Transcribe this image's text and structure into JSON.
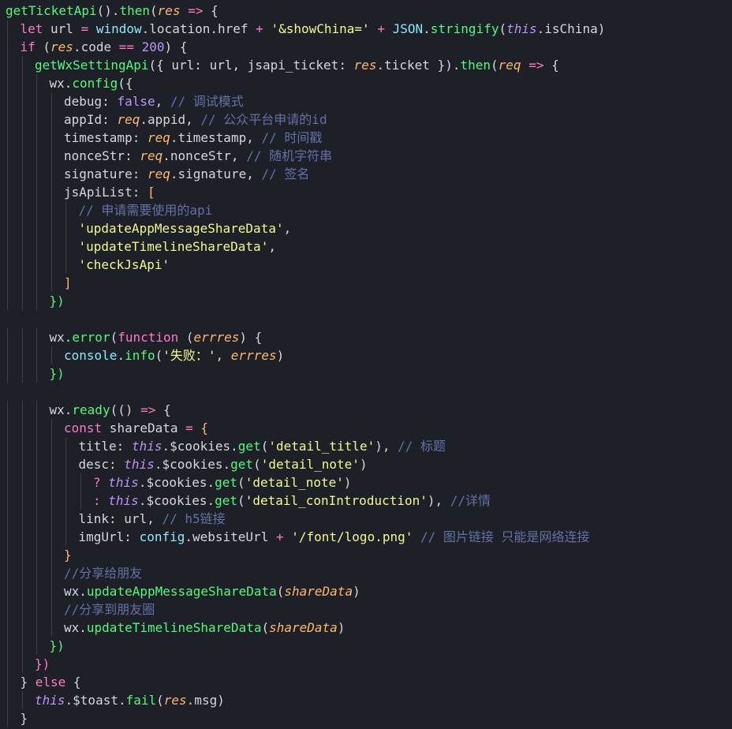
{
  "colors": {
    "background": "#1e2027",
    "default_text": "#d4d7de",
    "keyword": "#ff79c6",
    "function": "#50fa7b",
    "string": "#f1fa8c",
    "comment": "#6272a4",
    "param": "#ffb86c",
    "variable": "#8be9fd",
    "this": "#bd93f9",
    "number": "#bd93f9"
  },
  "editor": {
    "lines": [
      {
        "indent": 0,
        "tokens": [
          {
            "t": "getTicketApi",
            "c": "function"
          },
          {
            "t": "().",
            "c": "default"
          },
          {
            "t": "then",
            "c": "function"
          },
          {
            "t": "(",
            "c": "default"
          },
          {
            "t": "res",
            "c": "param",
            "i": true
          },
          {
            "t": " ",
            "c": "default"
          },
          {
            "t": "=>",
            "c": "keyword"
          },
          {
            "t": " {",
            "c": "default"
          }
        ]
      },
      {
        "indent": 1,
        "tokens": [
          {
            "t": "let",
            "c": "keyword"
          },
          {
            "t": " url ",
            "c": "default"
          },
          {
            "t": "=",
            "c": "keyword"
          },
          {
            "t": " ",
            "c": "default"
          },
          {
            "t": "window",
            "c": "variable"
          },
          {
            "t": ".location.href ",
            "c": "default"
          },
          {
            "t": "+",
            "c": "keyword"
          },
          {
            "t": " ",
            "c": "default"
          },
          {
            "t": "'&showChina='",
            "c": "string"
          },
          {
            "t": " ",
            "c": "default"
          },
          {
            "t": "+",
            "c": "keyword"
          },
          {
            "t": " ",
            "c": "default"
          },
          {
            "t": "JSON",
            "c": "variable"
          },
          {
            "t": ".",
            "c": "default"
          },
          {
            "t": "stringify",
            "c": "function"
          },
          {
            "t": "(",
            "c": "default"
          },
          {
            "t": "this",
            "c": "this",
            "i": true
          },
          {
            "t": ".isChina)",
            "c": "default"
          }
        ]
      },
      {
        "indent": 1,
        "tokens": [
          {
            "t": "if",
            "c": "keyword"
          },
          {
            "t": " (",
            "c": "default"
          },
          {
            "t": "res",
            "c": "param",
            "i": true
          },
          {
            "t": ".code ",
            "c": "default"
          },
          {
            "t": "==",
            "c": "keyword"
          },
          {
            "t": " ",
            "c": "default"
          },
          {
            "t": "200",
            "c": "number"
          },
          {
            "t": ") {",
            "c": "default"
          }
        ]
      },
      {
        "indent": 2,
        "tokens": [
          {
            "t": "getWxSettingApi",
            "c": "function"
          },
          {
            "t": "({ url: url, jsapi_ticket: ",
            "c": "default"
          },
          {
            "t": "res",
            "c": "param",
            "i": true
          },
          {
            "t": ".ticket }).",
            "c": "default"
          },
          {
            "t": "then",
            "c": "function"
          },
          {
            "t": "(",
            "c": "default"
          },
          {
            "t": "req",
            "c": "param",
            "i": true
          },
          {
            "t": " ",
            "c": "default"
          },
          {
            "t": "=>",
            "c": "keyword"
          },
          {
            "t": " {",
            "c": "default"
          }
        ]
      },
      {
        "indent": 3,
        "tokens": [
          {
            "t": "wx",
            "c": "default"
          },
          {
            "t": ".",
            "c": "default"
          },
          {
            "t": "config",
            "c": "function"
          },
          {
            "t": "({",
            "c": "default"
          }
        ]
      },
      {
        "indent": 4,
        "tokens": [
          {
            "t": "debug: ",
            "c": "default"
          },
          {
            "t": "false",
            "c": "this"
          },
          {
            "t": ", ",
            "c": "default"
          },
          {
            "t": "// 调试模式",
            "c": "comment"
          }
        ]
      },
      {
        "indent": 4,
        "tokens": [
          {
            "t": "appId: ",
            "c": "default"
          },
          {
            "t": "req",
            "c": "param",
            "i": true
          },
          {
            "t": ".appid, ",
            "c": "default"
          },
          {
            "t": "// 公众平台申请的id",
            "c": "comment"
          }
        ]
      },
      {
        "indent": 4,
        "tokens": [
          {
            "t": "timestamp: ",
            "c": "default"
          },
          {
            "t": "req",
            "c": "param",
            "i": true
          },
          {
            "t": ".timestamp, ",
            "c": "default"
          },
          {
            "t": "// 时间戳",
            "c": "comment"
          }
        ]
      },
      {
        "indent": 4,
        "tokens": [
          {
            "t": "nonceStr: ",
            "c": "default"
          },
          {
            "t": "req",
            "c": "param",
            "i": true
          },
          {
            "t": ".nonceStr, ",
            "c": "default"
          },
          {
            "t": "// 随机字符串",
            "c": "comment"
          }
        ]
      },
      {
        "indent": 4,
        "tokens": [
          {
            "t": "signature: ",
            "c": "default"
          },
          {
            "t": "req",
            "c": "param",
            "i": true
          },
          {
            "t": ".signature, ",
            "c": "default"
          },
          {
            "t": "// 签名",
            "c": "comment"
          }
        ]
      },
      {
        "indent": 4,
        "tokens": [
          {
            "t": "jsApiList: ",
            "c": "default"
          },
          {
            "t": "[",
            "c": "param"
          }
        ]
      },
      {
        "indent": 5,
        "tokens": [
          {
            "t": "// 申请需要使用的api",
            "c": "comment"
          }
        ]
      },
      {
        "indent": 5,
        "tokens": [
          {
            "t": "'updateAppMessageShareData'",
            "c": "string"
          },
          {
            "t": ",",
            "c": "default"
          }
        ]
      },
      {
        "indent": 5,
        "tokens": [
          {
            "t": "'updateTimelineShareData'",
            "c": "string"
          },
          {
            "t": ",",
            "c": "default"
          }
        ]
      },
      {
        "indent": 5,
        "tokens": [
          {
            "t": "'checkJsApi'",
            "c": "string"
          }
        ]
      },
      {
        "indent": 4,
        "tokens": [
          {
            "t": "]",
            "c": "param"
          }
        ]
      },
      {
        "indent": 3,
        "tokens": [
          {
            "t": "})",
            "c": "function"
          }
        ]
      },
      {
        "indent": 0,
        "tokens": []
      },
      {
        "indent": 3,
        "tokens": [
          {
            "t": "wx",
            "c": "default"
          },
          {
            "t": ".",
            "c": "default"
          },
          {
            "t": "error",
            "c": "function"
          },
          {
            "t": "(",
            "c": "default"
          },
          {
            "t": "function",
            "c": "keyword"
          },
          {
            "t": " (",
            "c": "default"
          },
          {
            "t": "errres",
            "c": "param",
            "i": true
          },
          {
            "t": ") {",
            "c": "default"
          }
        ]
      },
      {
        "indent": 4,
        "tokens": [
          {
            "t": "console",
            "c": "variable"
          },
          {
            "t": ".",
            "c": "default"
          },
          {
            "t": "info",
            "c": "function"
          },
          {
            "t": "(",
            "c": "default"
          },
          {
            "t": "'失败：'",
            "c": "string"
          },
          {
            "t": ", ",
            "c": "default"
          },
          {
            "t": "errres",
            "c": "param",
            "i": true
          },
          {
            "t": ")",
            "c": "default"
          }
        ]
      },
      {
        "indent": 3,
        "tokens": [
          {
            "t": "})",
            "c": "function"
          }
        ]
      },
      {
        "indent": 0,
        "tokens": []
      },
      {
        "indent": 3,
        "tokens": [
          {
            "t": "wx",
            "c": "default"
          },
          {
            "t": ".",
            "c": "default"
          },
          {
            "t": "ready",
            "c": "function"
          },
          {
            "t": "(() ",
            "c": "default"
          },
          {
            "t": "=>",
            "c": "keyword"
          },
          {
            "t": " {",
            "c": "default"
          }
        ]
      },
      {
        "indent": 4,
        "tokens": [
          {
            "t": "const",
            "c": "keyword"
          },
          {
            "t": " shareData ",
            "c": "default"
          },
          {
            "t": "=",
            "c": "keyword"
          },
          {
            "t": " {",
            "c": "param"
          }
        ]
      },
      {
        "indent": 5,
        "tokens": [
          {
            "t": "title: ",
            "c": "default"
          },
          {
            "t": "this",
            "c": "this",
            "i": true
          },
          {
            "t": ".$cookies.",
            "c": "default"
          },
          {
            "t": "get",
            "c": "function"
          },
          {
            "t": "(",
            "c": "default"
          },
          {
            "t": "'detail_title'",
            "c": "string"
          },
          {
            "t": "), ",
            "c": "default"
          },
          {
            "t": "// 标题",
            "c": "comment"
          }
        ]
      },
      {
        "indent": 5,
        "tokens": [
          {
            "t": "desc: ",
            "c": "default"
          },
          {
            "t": "this",
            "c": "this",
            "i": true
          },
          {
            "t": ".$cookies.",
            "c": "default"
          },
          {
            "t": "get",
            "c": "function"
          },
          {
            "t": "(",
            "c": "default"
          },
          {
            "t": "'detail_note'",
            "c": "string"
          },
          {
            "t": ")",
            "c": "default"
          }
        ]
      },
      {
        "indent": 6,
        "tokens": [
          {
            "t": "?",
            "c": "keyword"
          },
          {
            "t": " ",
            "c": "default"
          },
          {
            "t": "this",
            "c": "this",
            "i": true
          },
          {
            "t": ".$cookies.",
            "c": "default"
          },
          {
            "t": "get",
            "c": "function"
          },
          {
            "t": "(",
            "c": "default"
          },
          {
            "t": "'detail_note'",
            "c": "string"
          },
          {
            "t": ")",
            "c": "default"
          }
        ]
      },
      {
        "indent": 6,
        "tokens": [
          {
            "t": ":",
            "c": "keyword"
          },
          {
            "t": " ",
            "c": "default"
          },
          {
            "t": "this",
            "c": "this",
            "i": true
          },
          {
            "t": ".$cookies.",
            "c": "default"
          },
          {
            "t": "get",
            "c": "function"
          },
          {
            "t": "(",
            "c": "default"
          },
          {
            "t": "'detail_conIntroduction'",
            "c": "string"
          },
          {
            "t": "), ",
            "c": "default"
          },
          {
            "t": "//详情",
            "c": "comment"
          }
        ]
      },
      {
        "indent": 5,
        "tokens": [
          {
            "t": "link: url, ",
            "c": "default"
          },
          {
            "t": "// h5链接",
            "c": "comment"
          }
        ]
      },
      {
        "indent": 5,
        "tokens": [
          {
            "t": "imgUrl: ",
            "c": "default"
          },
          {
            "t": "config",
            "c": "variable"
          },
          {
            "t": ".websiteUrl ",
            "c": "default"
          },
          {
            "t": "+",
            "c": "keyword"
          },
          {
            "t": " ",
            "c": "default"
          },
          {
            "t": "'/font/logo.png'",
            "c": "string"
          },
          {
            "t": " ",
            "c": "default"
          },
          {
            "t": "// 图片链接 只能是网络连接",
            "c": "comment"
          }
        ]
      },
      {
        "indent": 4,
        "tokens": [
          {
            "t": "}",
            "c": "param"
          }
        ]
      },
      {
        "indent": 4,
        "tokens": [
          {
            "t": "//分享给朋友",
            "c": "comment"
          }
        ]
      },
      {
        "indent": 4,
        "tokens": [
          {
            "t": "wx",
            "c": "default"
          },
          {
            "t": ".",
            "c": "default"
          },
          {
            "t": "updateAppMessageShareData",
            "c": "function"
          },
          {
            "t": "(",
            "c": "default"
          },
          {
            "t": "shareData",
            "c": "param",
            "i": true
          },
          {
            "t": ")",
            "c": "default"
          }
        ]
      },
      {
        "indent": 4,
        "tokens": [
          {
            "t": "//分享到朋友圈",
            "c": "comment"
          }
        ]
      },
      {
        "indent": 4,
        "tokens": [
          {
            "t": "wx",
            "c": "default"
          },
          {
            "t": ".",
            "c": "default"
          },
          {
            "t": "updateTimelineShareData",
            "c": "function"
          },
          {
            "t": "(",
            "c": "default"
          },
          {
            "t": "shareData",
            "c": "param",
            "i": true
          },
          {
            "t": ")",
            "c": "default"
          }
        ]
      },
      {
        "indent": 3,
        "tokens": [
          {
            "t": "})",
            "c": "function"
          }
        ]
      },
      {
        "indent": 2,
        "tokens": [
          {
            "t": "})",
            "c": "keyword"
          }
        ]
      },
      {
        "indent": 1,
        "tokens": [
          {
            "t": "} ",
            "c": "default"
          },
          {
            "t": "else",
            "c": "keyword"
          },
          {
            "t": " {",
            "c": "default"
          }
        ]
      },
      {
        "indent": 2,
        "tokens": [
          {
            "t": "this",
            "c": "this",
            "i": true
          },
          {
            "t": ".$toast.",
            "c": "default"
          },
          {
            "t": "fail",
            "c": "function"
          },
          {
            "t": "(",
            "c": "default"
          },
          {
            "t": "res",
            "c": "param",
            "i": true
          },
          {
            "t": ".msg)",
            "c": "default"
          }
        ]
      },
      {
        "indent": 1,
        "tokens": [
          {
            "t": "}",
            "c": "default"
          }
        ]
      }
    ]
  }
}
